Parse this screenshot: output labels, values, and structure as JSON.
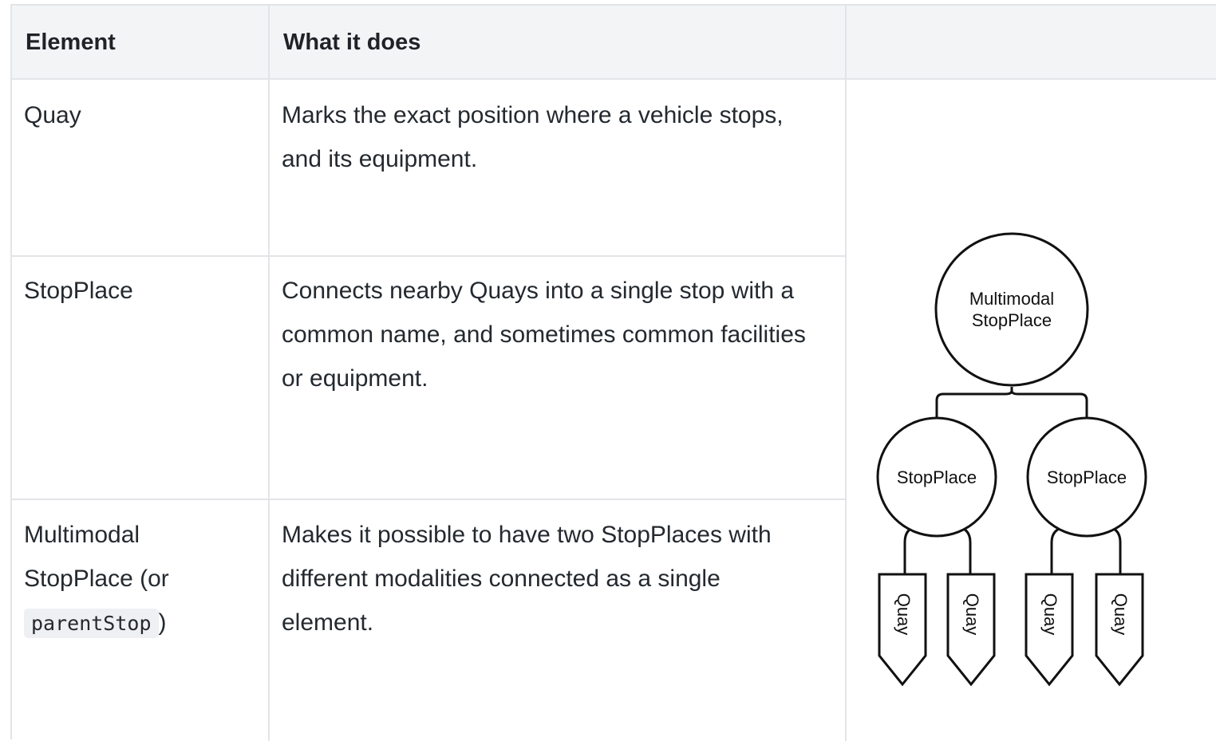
{
  "table": {
    "headers": [
      "Element",
      "What it does",
      ""
    ],
    "rows": [
      {
        "element": "Quay",
        "description": "Marks the exact position where a vehicle stops, and its equipment."
      },
      {
        "element": "StopPlace",
        "description": "Connects nearby Quays into a single stop with a common name, and sometimes common facilities or equipment."
      },
      {
        "element_line1": "Multimodal",
        "element_line2": "StopPlace (or",
        "element_code": "parentStop",
        "element_suffix": ")",
        "description": "Makes it possible to have two StopPlaces with different modalities connected as a single element."
      }
    ]
  },
  "diagram": {
    "root_line1": "Multimodal",
    "root_line2": "StopPlace",
    "child_left": "StopPlace",
    "child_right": "StopPlace",
    "leaves": [
      "Quay",
      "Quay",
      "Quay",
      "Quay"
    ]
  }
}
